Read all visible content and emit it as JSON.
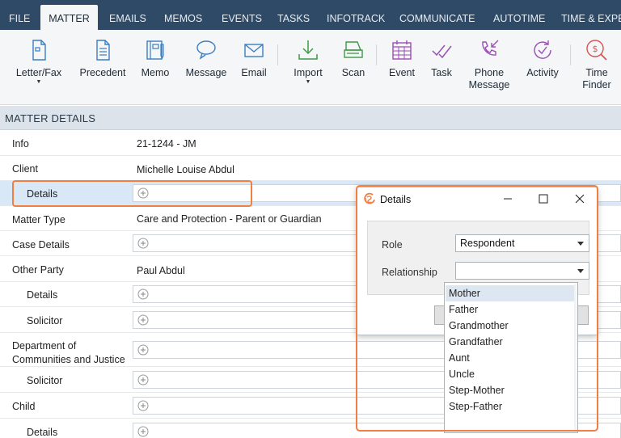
{
  "tabs": [
    {
      "label": "FILE",
      "active": false
    },
    {
      "label": "MATTER",
      "active": true
    },
    {
      "label": "EMAILS",
      "active": false
    },
    {
      "label": "MEMOS",
      "active": false
    },
    {
      "label": "EVENTS",
      "active": false
    },
    {
      "label": "TASKS",
      "active": false
    },
    {
      "label": "INFOTRACK",
      "active": false
    },
    {
      "label": "COMMUNICATE",
      "active": false
    },
    {
      "label": "AUTOTIME",
      "active": false
    },
    {
      "label": "TIME & EXPEN",
      "active": false
    }
  ],
  "ribbon": [
    {
      "label": "Letter/Fax",
      "icon": "document-icon",
      "has_dropdown": true
    },
    {
      "label": "Precedent",
      "icon": "precedent-icon"
    },
    {
      "label": "Memo",
      "icon": "memo-icon"
    },
    {
      "label": "Message",
      "icon": "chat-bubble-icon"
    },
    {
      "label": "Email",
      "icon": "envelope-icon"
    },
    {
      "label": "Import",
      "icon": "download-icon",
      "has_dropdown": true
    },
    {
      "label": "Scan",
      "icon": "scanner-icon"
    },
    {
      "label": "Event",
      "icon": "calendar-icon"
    },
    {
      "label": "Task",
      "icon": "task-check-icon"
    },
    {
      "label": "Phone",
      "label2": "Message",
      "icon": "phone-icon"
    },
    {
      "label": "Activity",
      "icon": "activity-icon"
    },
    {
      "label": "Time",
      "label2": "Finder",
      "icon": "time-finder-icon"
    }
  ],
  "section_title": "MATTER DETAILS",
  "rows": [
    {
      "label": "Info",
      "value": "21-1244 - JM"
    },
    {
      "label": "Client",
      "value": "Michelle Louise Abdul"
    },
    {
      "label": "Details",
      "value": ""
    },
    {
      "label": "Matter Type",
      "value": "Care and Protection - Parent or Guardian"
    },
    {
      "label": "Case Details",
      "value": ""
    },
    {
      "label": "Other Party",
      "value": "Paul Abdul"
    },
    {
      "label": "Details",
      "value": ""
    },
    {
      "label": "Solicitor",
      "value": ""
    },
    {
      "label": "Department of",
      "label2": "Communities and Justice",
      "value": ""
    },
    {
      "label": "Solicitor",
      "value": ""
    },
    {
      "label": "Child",
      "value": ""
    },
    {
      "label": "Details",
      "value": ""
    }
  ],
  "dialog": {
    "title": "Details",
    "role_label": "Role",
    "role_value": "Respondent",
    "relationship_label": "Relationship",
    "relationship_value": "",
    "options": [
      "Mother",
      "Father",
      "Grandmother",
      "Grandfather",
      "Aunt",
      "Uncle",
      "Step-Mother",
      "Step-Father"
    ],
    "hovered_option": "Mother"
  },
  "colors": {
    "tabbar": "#2e4a66",
    "accent": "#f07f43",
    "icon_blue": "#3a7fc1",
    "icon_green": "#3d9a47",
    "icon_purple": "#9b4fb3",
    "icon_red": "#d9534f",
    "selected_row": "#d9e8f6"
  }
}
